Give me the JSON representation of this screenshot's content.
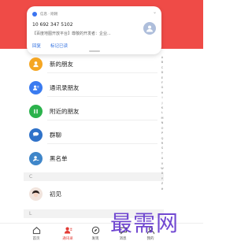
{
  "notification": {
    "app_name": "信息 · 刚刚",
    "sender": "10 692 347 5102",
    "body": "【百度地图开放平台】尊敬的开发者：企业...",
    "actions": [
      "回复",
      "标记已读"
    ]
  },
  "contacts": {
    "function_items": [
      {
        "label": "新的朋友",
        "icon": "person-add-icon",
        "color": "#f5a623"
      },
      {
        "label": "通讯录朋友",
        "icon": "address-book-icon",
        "color": "#3a7bf0"
      },
      {
        "label": "附近的朋友",
        "icon": "nearby-icon",
        "color": "#2bb24c"
      },
      {
        "label": "群聊",
        "icon": "group-chat-icon",
        "color": "#2f72c9"
      },
      {
        "label": "黑名单",
        "icon": "blacklist-icon",
        "color": "#3f86c9"
      }
    ],
    "sections": [
      {
        "letter": "C",
        "contacts": [
          {
            "name": "初见",
            "icon": "avatar-icon"
          }
        ]
      },
      {
        "letter": "L",
        "contacts": []
      }
    ]
  },
  "alpha_index": [
    "A",
    "B",
    "C",
    "D",
    "E",
    "F",
    "G",
    "H",
    "I",
    "J",
    "K",
    "L",
    "M",
    "N",
    "O",
    "P",
    "Q",
    "R",
    "S",
    "T",
    "U",
    "V",
    "W",
    "X",
    "Y",
    "Z",
    "#"
  ],
  "bottom_nav": [
    {
      "label": "首页",
      "icon": "home-icon"
    },
    {
      "label": "通讯录",
      "icon": "contacts-icon",
      "active": true
    },
    {
      "label": "发现",
      "icon": "discover-icon"
    },
    {
      "label": "消息",
      "icon": "message-icon"
    },
    {
      "label": "我的",
      "icon": "profile-icon"
    }
  ],
  "watermark": "最需网",
  "colors": {
    "brand_red": "#ef4b47",
    "active_nav": "#e23b35",
    "watermark": "#6a3fcf"
  }
}
